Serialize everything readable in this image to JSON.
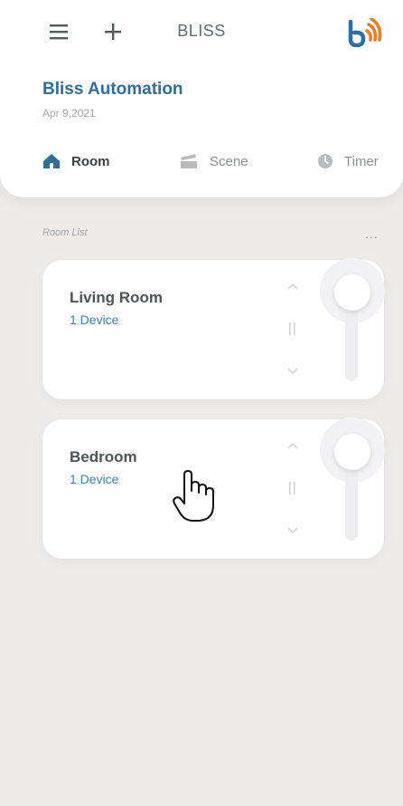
{
  "header": {
    "title": "BLISS",
    "menu_icon": "hamburger-menu-icon",
    "add_icon": "plus-icon",
    "logo_icon": "bliss-logo-icon"
  },
  "app": {
    "name": "Bliss Automation",
    "date": "Apr 9,2021"
  },
  "tabs": [
    {
      "label": "Room",
      "icon": "home-icon",
      "active": true
    },
    {
      "label": "Scene",
      "icon": "scene-icon",
      "active": false
    },
    {
      "label": "Timer",
      "icon": "clock-icon",
      "active": false
    }
  ],
  "room_list": {
    "label": "Room List",
    "more": "...",
    "rooms": [
      {
        "name": "Living Room",
        "devices": "1 Device"
      },
      {
        "name": "Bedroom",
        "devices": "1 Device"
      }
    ]
  },
  "colors": {
    "accent": "#2f6f9a",
    "link": "#3e80a9",
    "logo_blue": "#2e6ea6",
    "logo_orange": "#f47b20",
    "background": "#efebe9"
  }
}
